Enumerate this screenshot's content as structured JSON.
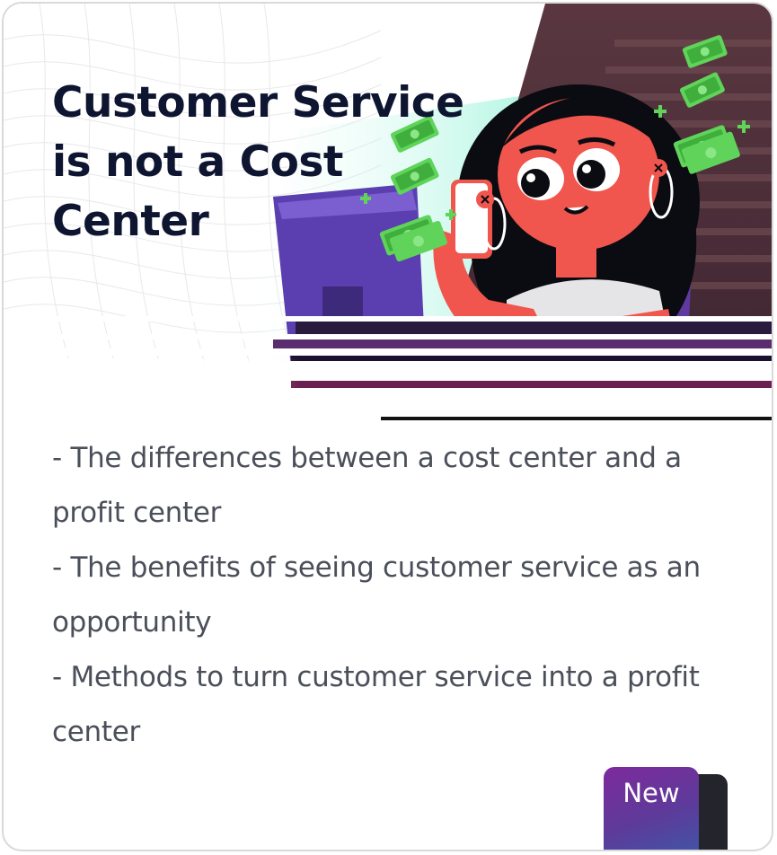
{
  "card": {
    "title": "Customer Service is not a Cost Center",
    "bullets": [
      "- The differences between a cost center and a",
      "profit center",
      "- The benefits of seeing customer service as an",
      "opportunity",
      "- Methods to turn customer service into a profit",
      "center"
    ],
    "badge_label": "New"
  },
  "colors": {
    "title": "#0e1530",
    "body_text": "#4b4f5a",
    "accent_mint": "#3ee6b6",
    "skin": "#f0564d",
    "badge_gradient_start": "#7d2a9c",
    "badge_gradient_end": "#3b5aa8"
  }
}
